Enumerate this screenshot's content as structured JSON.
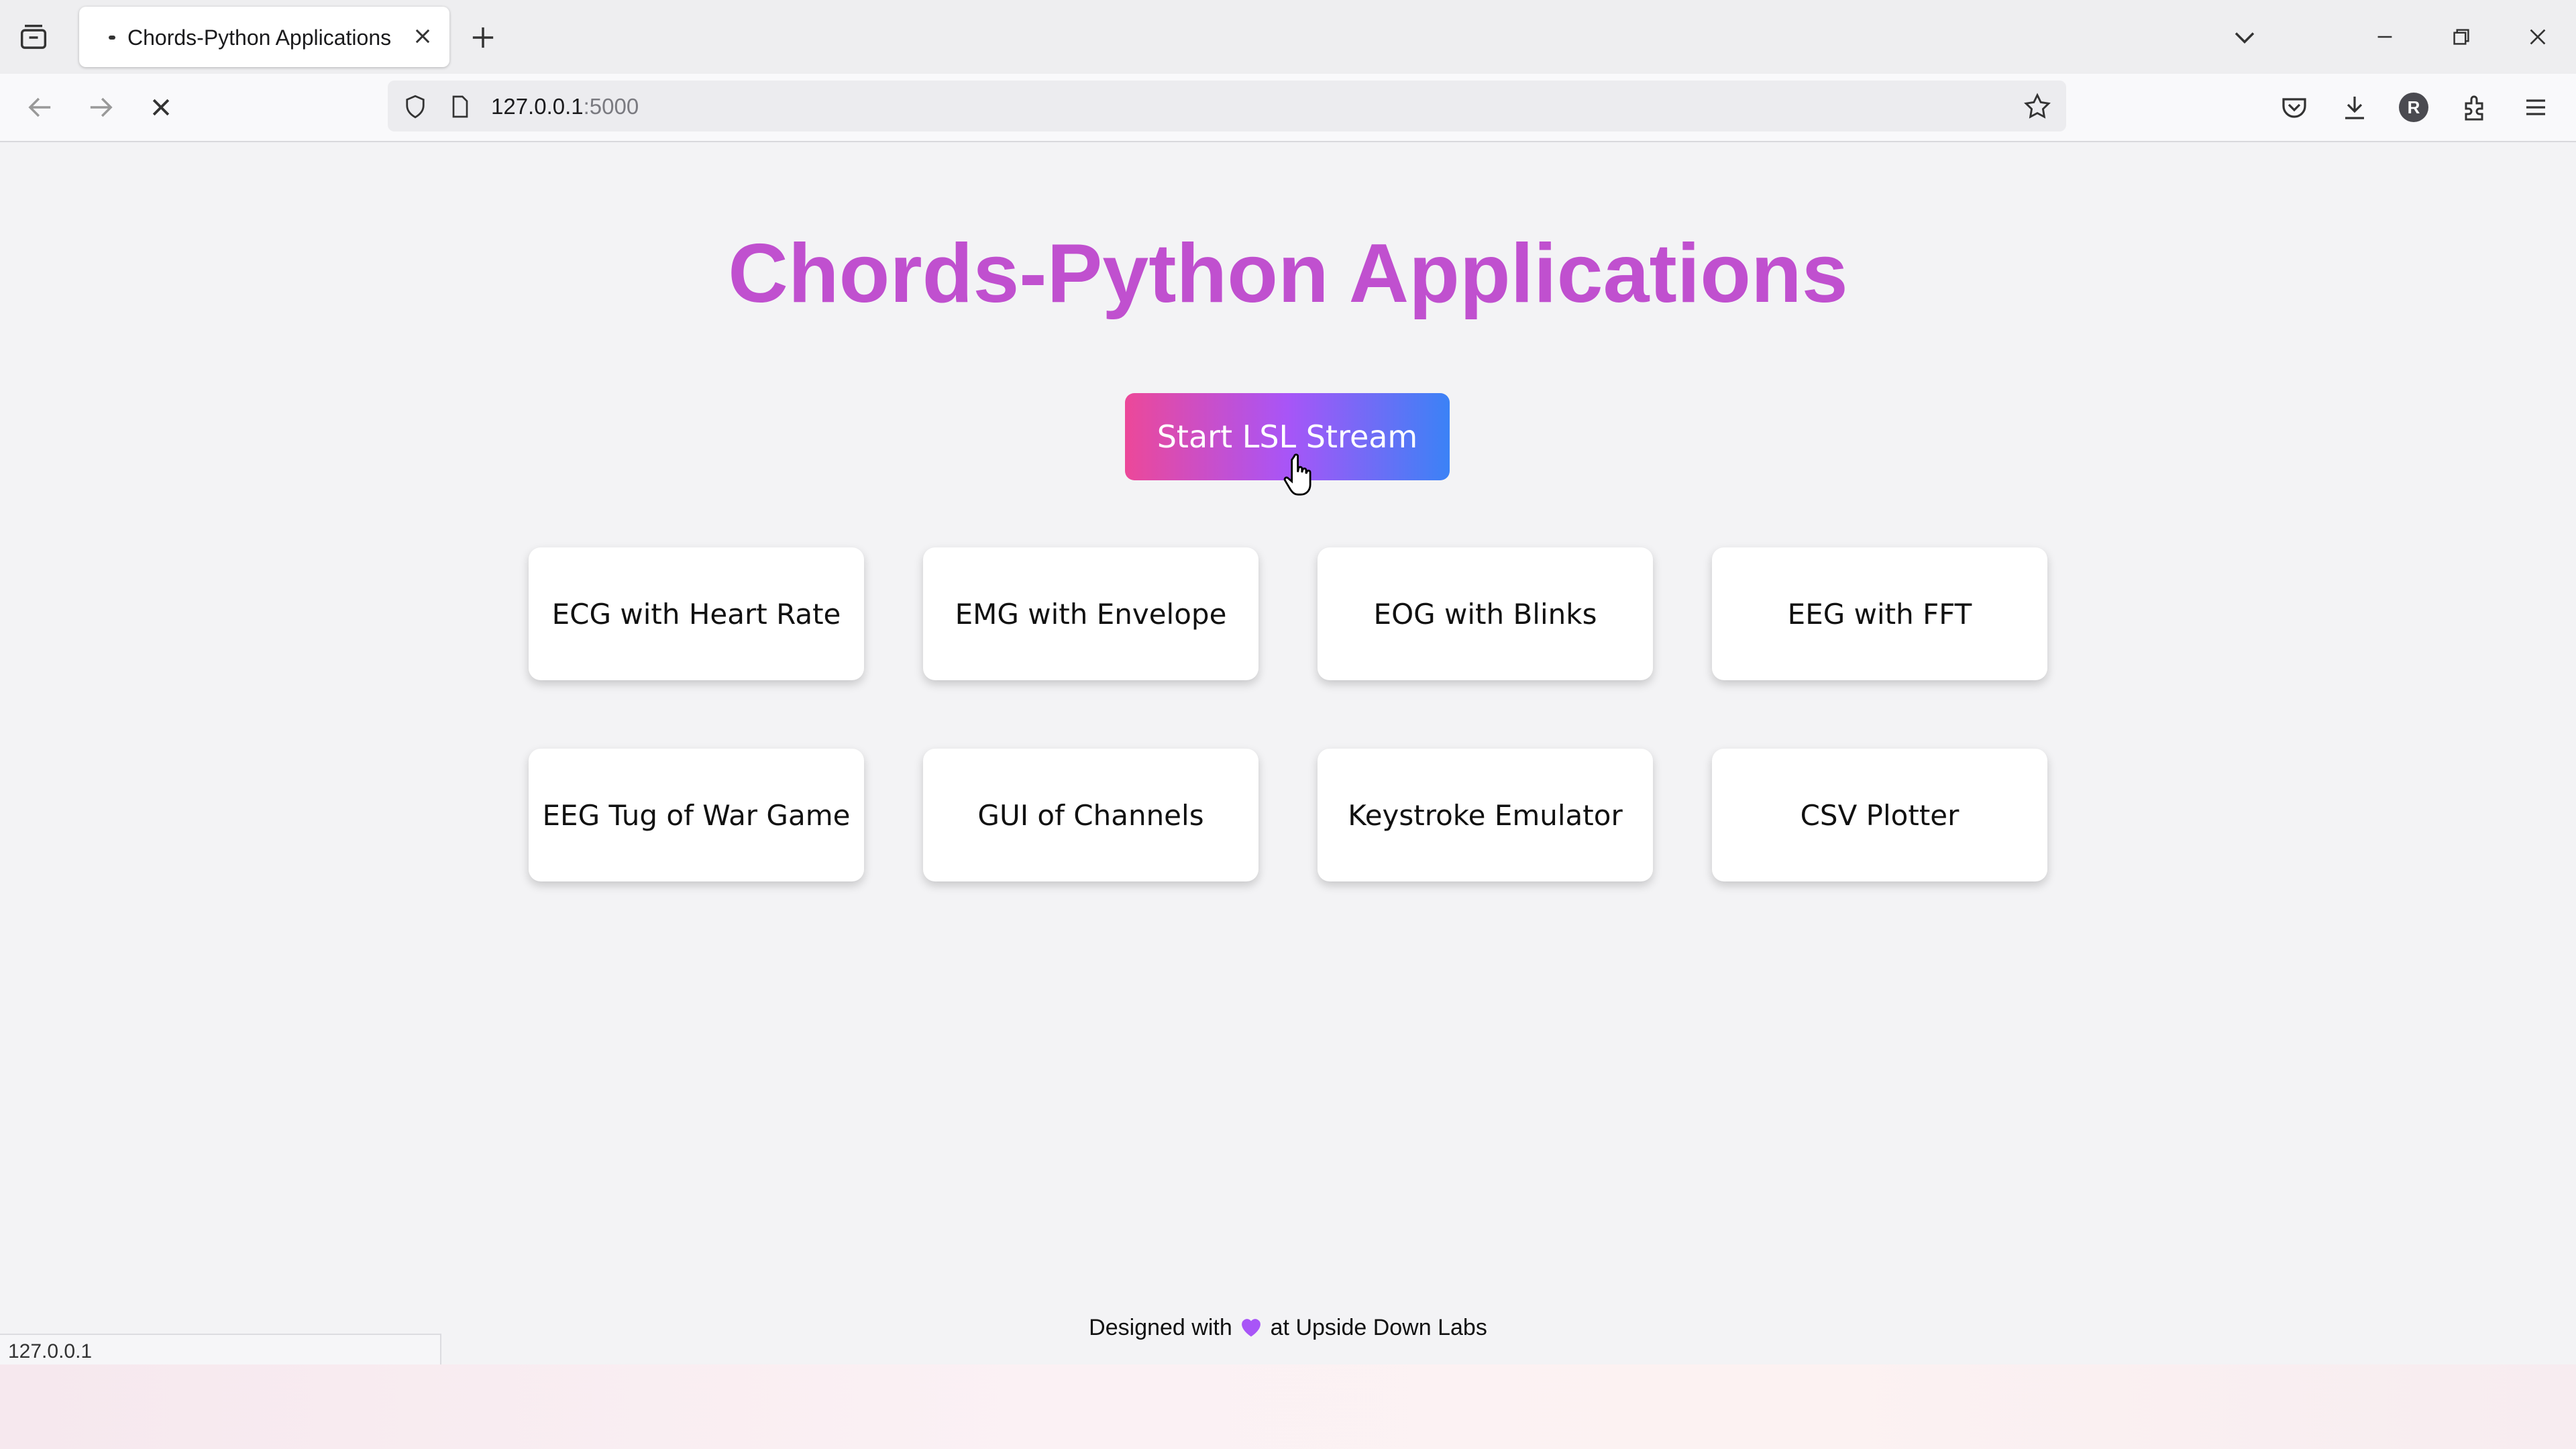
{
  "browser": {
    "tab_title": "Chords-Python Applications",
    "url_host": "127.0.0.1",
    "url_port": ":5000",
    "avatar_letter": "R",
    "status_url": "127.0.0.1"
  },
  "page": {
    "title": "Chords-Python Applications",
    "start_button": "Start LSL Stream",
    "apps": [
      "ECG with Heart Rate",
      "EMG with Envelope",
      "EOG with Blinks",
      "EEG with FFT",
      "EEG Tug of War Game",
      "GUI of Channels",
      "Keystroke Emulator",
      "CSV Plotter"
    ],
    "footer_before": "Designed with",
    "footer_after": "at Upside Down Labs"
  },
  "colors": {
    "title": "#c050cf",
    "button_gradient_start": "#ec4899",
    "button_gradient_mid": "#a855f7",
    "button_gradient_end": "#3b82f6",
    "heart": "#a855f7"
  },
  "icons": [
    "tab-manager-icon",
    "tab-close-icon",
    "new-tab-icon",
    "back-icon",
    "forward-icon",
    "stop-loading-icon",
    "shield-icon",
    "page-icon",
    "bookmark-star-icon",
    "pocket-icon",
    "download-icon",
    "extensions-icon",
    "menu-icon",
    "chevron-down-icon",
    "minimize-icon",
    "restore-icon",
    "close-window-icon",
    "heart-icon",
    "hand-cursor-icon"
  ]
}
